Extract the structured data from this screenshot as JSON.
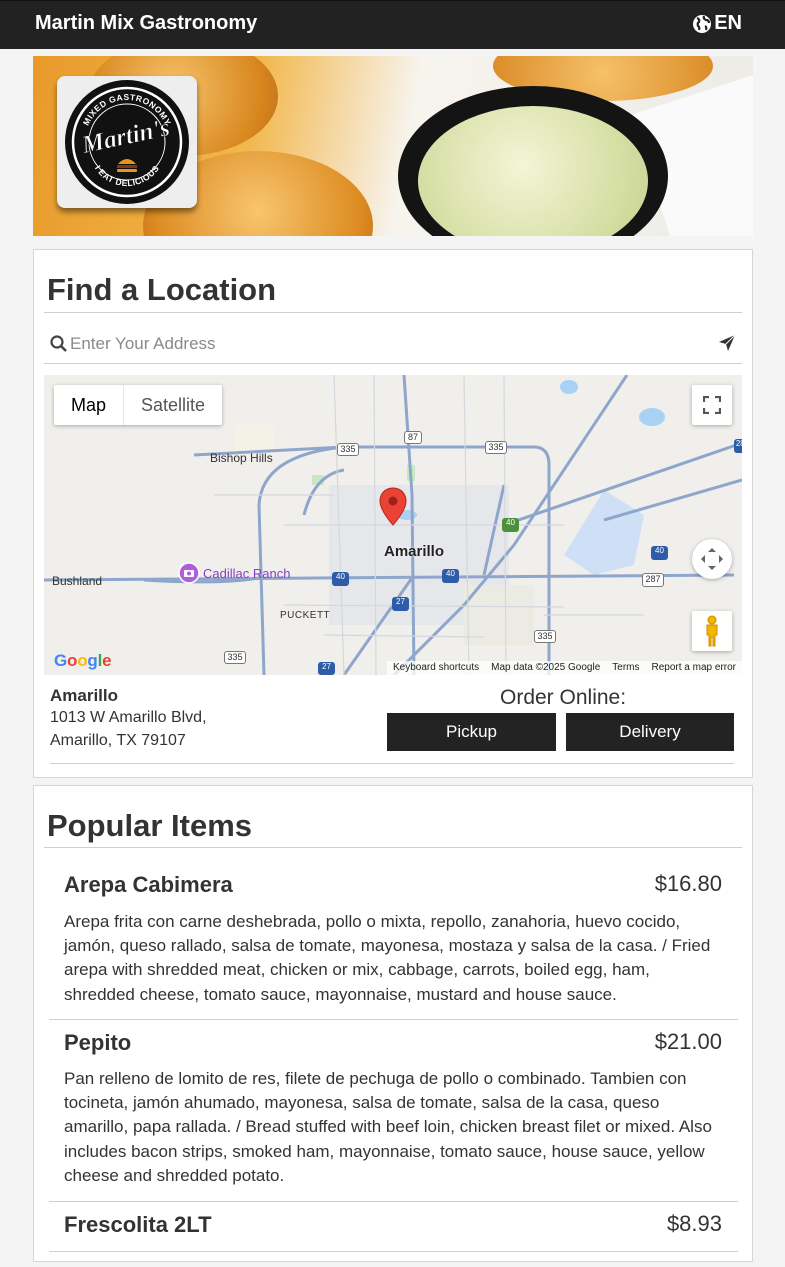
{
  "header": {
    "brand": "Martin Mix Gastronomy",
    "language": "EN"
  },
  "logo": {
    "top_text": "MIXED GASTRONOMY",
    "name": "Martin's",
    "bottom_text": "I EAT DELICIOUS"
  },
  "location_section": {
    "title": "Find a Location",
    "search_placeholder": "Enter Your Address",
    "map": {
      "type_map": "Map",
      "type_satellite": "Satellite",
      "places": {
        "bishop_hills": "Bishop Hills",
        "amarillo": "Amarillo",
        "bushland": "Bushland",
        "cadillac_ranch": "Cadillac Ranch",
        "puckett": "PUCKETT"
      },
      "shields": [
        "87",
        "335",
        "335",
        "40",
        "40",
        "40",
        "40",
        "287",
        "27",
        "27",
        "335",
        "335"
      ],
      "footer": {
        "shortcuts": "Keyboard shortcuts",
        "data": "Map data ©2025 Google",
        "terms": "Terms",
        "report": "Report a map error"
      },
      "google": "Google"
    },
    "store": {
      "name": "Amarillo",
      "address_line1": "1013 W Amarillo Blvd,",
      "address_line2": "Amarillo, TX 79107"
    },
    "order_title": "Order Online:",
    "pickup": "Pickup",
    "delivery": "Delivery"
  },
  "popular": {
    "title": "Popular Items",
    "items": [
      {
        "name": "Arepa Cabimera",
        "price": "$16.80",
        "desc": "Arepa frita con carne deshebrada, pollo o mixta, repollo, zanahoria, huevo cocido, jamón, queso rallado, salsa de tomate, mayonesa, mostaza y salsa de la casa. / Fried arepa with shredded meat, chicken or mix, cabbage, carrots, boiled egg, ham, shredded cheese, tomato sauce, mayonnaise, mustard and house sauce."
      },
      {
        "name": "Pepito",
        "price": "$21.00",
        "desc": "Pan relleno de lomito de res, filete de pechuga de pollo o combinado. Tambien con tocineta, jamón ahumado, mayonesa, salsa de tomate, salsa de la casa, queso amarillo, papa rallada. / Bread stuffed with beef loin, chicken breast filet or mixed. Also includes bacon strips, smoked ham, mayonnaise, tomato sauce, house sauce, yellow cheese and shredded potato."
      },
      {
        "name": "Frescolita 2LT",
        "price": "$8.93"
      }
    ]
  }
}
